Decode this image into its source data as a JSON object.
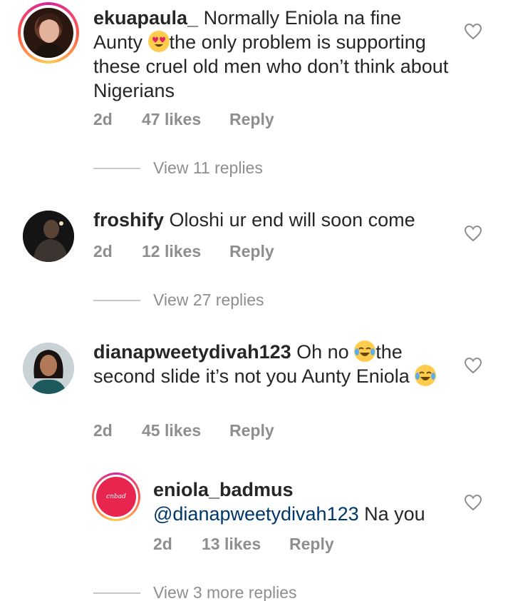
{
  "comments": [
    {
      "username": "ekuapaula_",
      "text_before": "Normally Eniola na fine Aunty ",
      "emoji1": "heart-eyes",
      "text_after": "the only problem is supporting these cruel old men who don’t think about Nigerians",
      "time": "2d",
      "likes": "47 likes",
      "reply": "Reply",
      "view_replies": "View 11 replies"
    },
    {
      "username": "froshify",
      "text": "Oloshi ur end will soon come",
      "time": "2d",
      "likes": "12 likes",
      "reply": "Reply",
      "view_replies": "View 27 replies"
    },
    {
      "username": "dianapweetydivah123",
      "text_before": "Oh no ",
      "emoji1": "tears-of-joy",
      "text_mid": "the second slide it’s not you Aunty Eniola",
      "emoji2": "tears-of-joy",
      "time": "2d",
      "likes": "45 likes",
      "reply": "Reply"
    },
    {
      "username": "eniola_badmus",
      "mention": "@dianapweetydivah123",
      "text": " Na you",
      "time": "2d",
      "likes": "13 likes",
      "reply": "Reply",
      "view_replies": "View 3 more replies",
      "avatar_logo": "cnbad"
    }
  ],
  "colors": {
    "text": "#262626",
    "muted": "#8e8e8e",
    "mention": "#00376b"
  }
}
